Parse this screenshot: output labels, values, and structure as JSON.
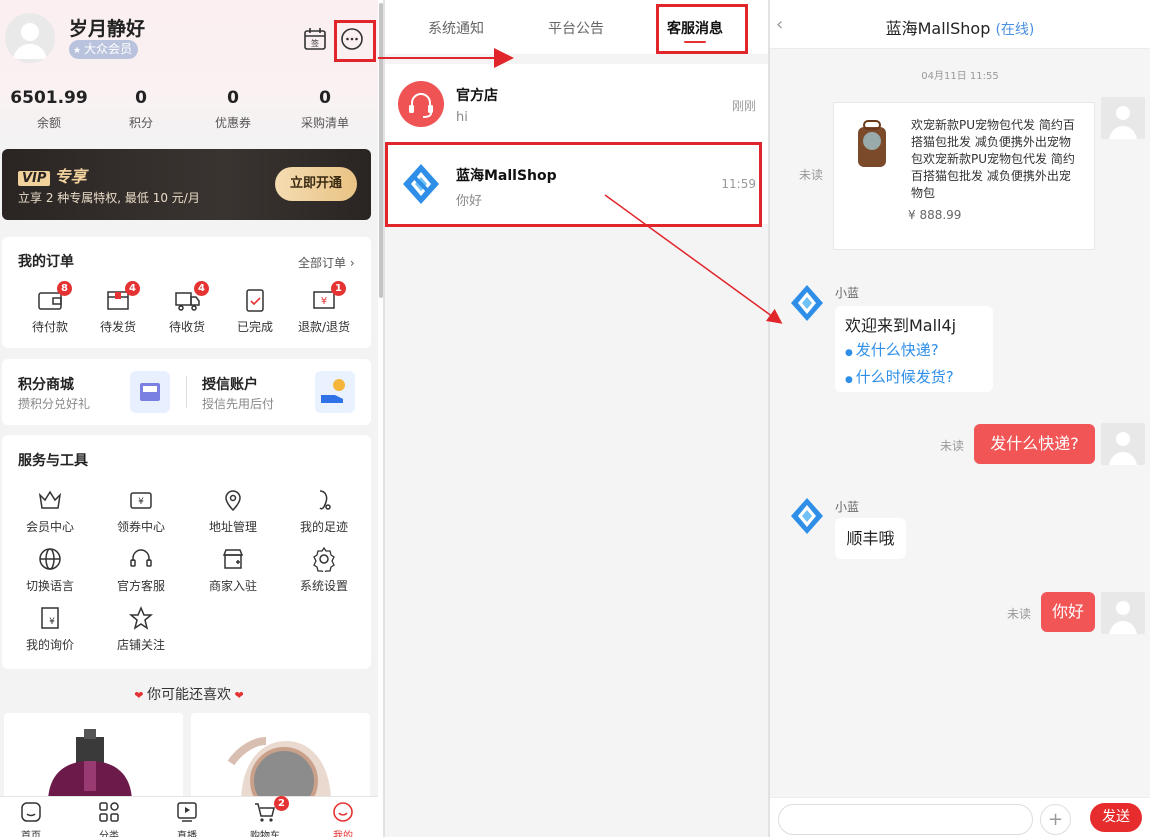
{
  "profile": {
    "username": "岁月静好",
    "member_badge": "大众会员"
  },
  "stats": [
    {
      "value": "6501.99",
      "label": "余额"
    },
    {
      "value": "0",
      "label": "积分"
    },
    {
      "value": "0",
      "label": "优惠券"
    },
    {
      "value": "0",
      "label": "采购清单"
    }
  ],
  "vip": {
    "logo": "VIP",
    "title": "专享",
    "subtitle": "立享 2 种专属特权, 最低 10 元/月",
    "button": "立即开通"
  },
  "orders": {
    "title": "我的订单",
    "all_label": "全部订单",
    "items": [
      {
        "label": "待付款",
        "badge": "8",
        "icon": "wallet-icon"
      },
      {
        "label": "待发货",
        "badge": "4",
        "icon": "package-icon"
      },
      {
        "label": "待收货",
        "badge": "4",
        "icon": "truck-icon"
      },
      {
        "label": "已完成",
        "badge": "",
        "icon": "clipboard-check-icon"
      },
      {
        "label": "退款/退货",
        "badge": "1",
        "icon": "refund-icon"
      }
    ]
  },
  "mall": {
    "points_title": "积分商城",
    "points_sub": "攒积分兑好礼",
    "credit_title": "授信账户",
    "credit_sub": "授信先用后付"
  },
  "services": {
    "title": "服务与工具",
    "items": [
      {
        "label": "会员中心",
        "icon": "crown-icon"
      },
      {
        "label": "领券中心",
        "icon": "coupon-icon"
      },
      {
        "label": "地址管理",
        "icon": "location-pin-icon"
      },
      {
        "label": "我的足迹",
        "icon": "footprint-icon"
      },
      {
        "label": "切换语言",
        "icon": "globe-icon"
      },
      {
        "label": "官方客服",
        "icon": "headset-icon"
      },
      {
        "label": "商家入驻",
        "icon": "store-icon"
      },
      {
        "label": "系统设置",
        "icon": "gear-icon"
      },
      {
        "label": "我的询价",
        "icon": "inquiry-icon"
      },
      {
        "label": "店铺关注",
        "icon": "star-icon"
      }
    ]
  },
  "recommend": {
    "title": "你可能还喜欢"
  },
  "tabbar": [
    {
      "label": "首页",
      "icon": "home-icon"
    },
    {
      "label": "分类",
      "icon": "category-icon"
    },
    {
      "label": "直播",
      "icon": "live-icon"
    },
    {
      "label": "购物车",
      "icon": "cart-icon",
      "badge": "2"
    },
    {
      "label": "我的",
      "icon": "profile-icon",
      "active": true
    }
  ],
  "messages": {
    "tabs": [
      "系统通知",
      "平台公告",
      "客服消息"
    ],
    "active_tab": 2,
    "conversations": [
      {
        "name": "官方店",
        "last": "hi",
        "time": "刚刚"
      },
      {
        "name": "蓝海MallShop",
        "last": "你好",
        "time": "11:59"
      }
    ]
  },
  "chat": {
    "title": "蓝海MallShop",
    "status": "(在线)",
    "timestamp": "04月11日 11:55",
    "product": {
      "description": "欢宠新款PU宠物包代发 简约百搭猫包批发 减负便携外出宠物包欢宠新款PU宠物包代发 简约百搭猫包批发 减负便携外出宠物包",
      "price": "¥ 888.99",
      "status": "未读"
    },
    "bot_name": "小蓝",
    "welcome": "欢迎来到Mall4j",
    "questions": [
      "发什么快递?",
      "什么时候发货?"
    ],
    "user_msg1": "发什么快递?",
    "user_msg1_status": "未读",
    "bot_reply": "顺丰哦",
    "user_msg2": "你好",
    "user_msg2_status": "未读",
    "send_label": "发送",
    "plus_label": "+"
  },
  "colors": {
    "accent": "#e0252b",
    "link": "#2f8fe8",
    "bubble_user": "#f25555"
  }
}
